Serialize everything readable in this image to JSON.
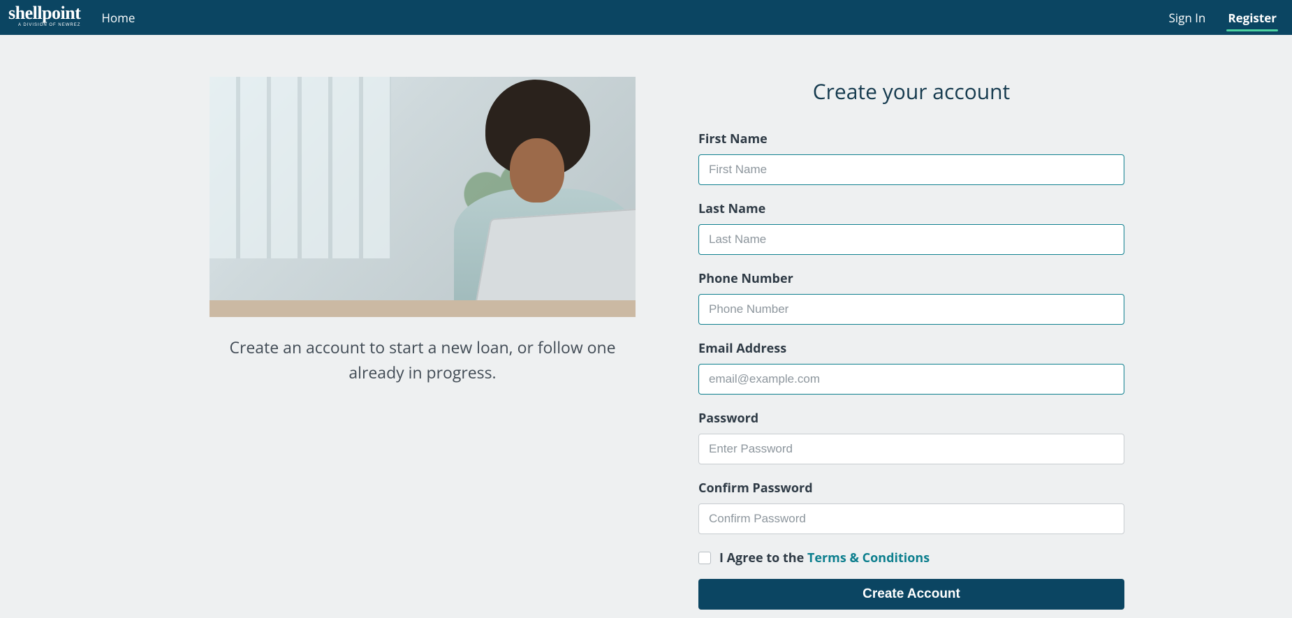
{
  "brand": {
    "name": "shellpoint",
    "tagline": "A DIVISION OF NEWREZ"
  },
  "nav": {
    "home": "Home",
    "signin": "Sign In",
    "register": "Register"
  },
  "hero": {
    "caption": "Create an account to start a new loan, or follow one already in progress."
  },
  "form": {
    "title": "Create your account",
    "first_name": {
      "label": "First Name",
      "placeholder": "First Name"
    },
    "last_name": {
      "label": "Last Name",
      "placeholder": "Last Name"
    },
    "phone": {
      "label": "Phone Number",
      "placeholder": "Phone Number"
    },
    "email": {
      "label": "Email Address",
      "placeholder": "email@example.com"
    },
    "password": {
      "label": "Password",
      "placeholder": "Enter Password"
    },
    "confirm_password": {
      "label": "Confirm Password",
      "placeholder": "Confirm Password"
    },
    "agree_prefix": "I Agree to the ",
    "terms_link": "Terms & Conditions",
    "submit": "Create Account"
  }
}
